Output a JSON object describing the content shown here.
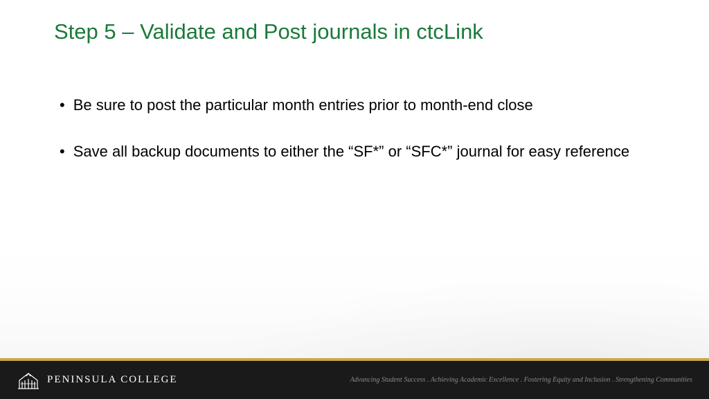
{
  "title": "Step 5 – Validate and Post journals in ctcLink",
  "bullets": [
    "Be sure to post the particular month entries prior to month-end close",
    "Save all backup documents to either the “SF*” or “SFC*” journal for easy reference"
  ],
  "footer": {
    "college_name": "PENINSULA COLLEGE",
    "tagline": "Advancing Student Success . Achieving Academic Excellence . Fostering Equity and Inclusion . Strengthening Communities"
  }
}
